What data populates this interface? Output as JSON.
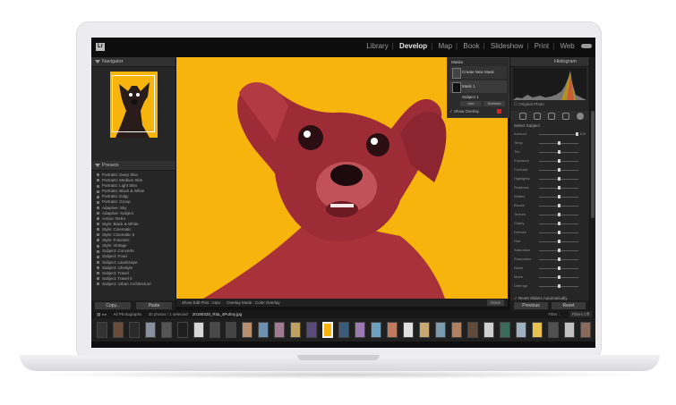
{
  "app": {
    "logo": "Lr",
    "modules": [
      "Library",
      "Develop",
      "Map",
      "Book",
      "Slideshow",
      "Print",
      "Web"
    ],
    "active_module": "Develop",
    "cloud_icon": "cloud-icon"
  },
  "left_panel": {
    "navigator_title": "Navigator",
    "presets_title": "Presets",
    "presets": [
      "Portraits: Deep Skin",
      "Portraits: Medium Skin",
      "Portraits: Light Skin",
      "Portraits: Black & White",
      "Portraits: Edgy",
      "Portraits: Group",
      "Adaptive: Sky",
      "Adaptive: Subject",
      "Action: Retro",
      "Style: Black & White",
      "Style: Cinematic",
      "Style: Cinematic II",
      "Style: Futuristic",
      "Style: Vintage",
      "Subject: Concerts",
      "Subject: Food",
      "Subject: Landscape",
      "Subject: Lifestyle",
      "Subject: Travel",
      "Subject: Travel II",
      "Subject: Urban Architecture"
    ],
    "copy_label": "Copy...",
    "paste_label": "Paste"
  },
  "masks_panel": {
    "title": "Masks",
    "create_label": "Create New Mask",
    "mask1_label": "Mask 1",
    "subject_label": "Subject 1",
    "add_label": "Add",
    "subtract_label": "Subtract",
    "show_overlay_label": "Show Overlay",
    "overlay_color": "#e02020"
  },
  "right_panel": {
    "histogram_title": "Histogram",
    "original_photo_label": "Original Photo",
    "select_subject_label": "Select Subject",
    "sliders": [
      {
        "label": "Amount",
        "value": "100",
        "level": 1.0
      },
      {
        "label": "Temp",
        "value": "",
        "level": 0.5
      },
      {
        "label": "Tint",
        "value": "",
        "level": 0.5
      },
      {
        "label": "Exposure",
        "value": "",
        "level": 0.5
      },
      {
        "label": "Contrast",
        "value": "",
        "level": 0.5
      },
      {
        "label": "Highlights",
        "value": "",
        "level": 0.5
      },
      {
        "label": "Shadows",
        "value": "",
        "level": 0.5
      },
      {
        "label": "Whites",
        "value": "",
        "level": 0.5
      },
      {
        "label": "Blacks",
        "value": "",
        "level": 0.5
      },
      {
        "label": "Texture",
        "value": "",
        "level": 0.5
      },
      {
        "label": "Clarity",
        "value": "",
        "level": 0.5
      },
      {
        "label": "Dehaze",
        "value": "",
        "level": 0.5
      },
      {
        "label": "Hue",
        "value": "",
        "level": 0.5
      },
      {
        "label": "Saturation",
        "value": "",
        "level": 0.5
      },
      {
        "label": "Sharpness",
        "value": "",
        "level": 0.5
      },
      {
        "label": "Noise",
        "value": "",
        "level": 0.5
      },
      {
        "label": "Moire",
        "value": "",
        "level": 0.5
      },
      {
        "label": "Defringe",
        "value": "",
        "level": 0.5
      }
    ],
    "reset_label": "Reset Sliders Automatically",
    "previous_label": "Previous",
    "reset_btn_label": "Reset"
  },
  "toolbar": {
    "show_edit_pins": "Show Edit Pins : Auto",
    "overlay_mode": "Overlay Mode : Color Overlay",
    "done_label": "Done"
  },
  "filmstrip": {
    "source": "All Photographs",
    "count": "30 photos / 1 selected",
    "filename": "20190328_Rita_4Puhny.jpg",
    "filter_label": "Filter :",
    "filter_value": "Filters Off"
  }
}
